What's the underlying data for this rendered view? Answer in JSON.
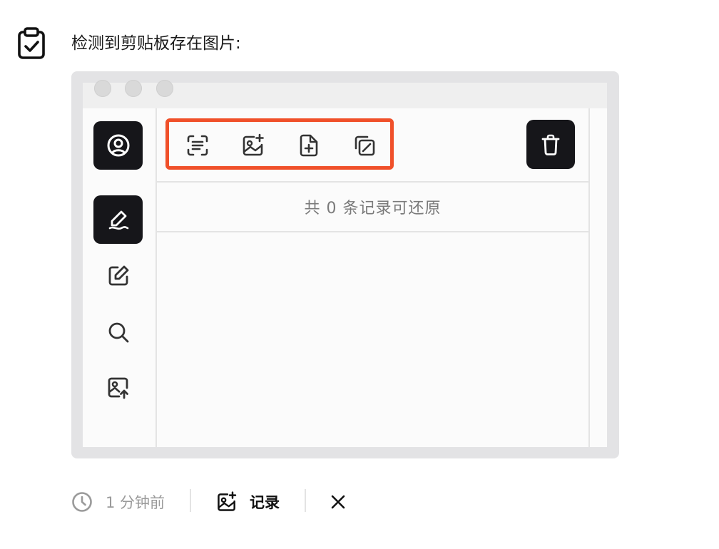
{
  "header": {
    "message": "检测到剪贴板存在图片:",
    "icon": "clipboard-check-icon"
  },
  "preview": {
    "sidebar": {
      "items": [
        {
          "icon": "user-circle-icon",
          "active": true
        },
        {
          "icon": "signature-icon",
          "active": true
        },
        {
          "icon": "edit-icon",
          "active": false
        },
        {
          "icon": "search-icon",
          "active": false
        },
        {
          "icon": "image-upload-icon",
          "active": false
        }
      ]
    },
    "toolbar": {
      "tools": [
        {
          "icon": "text-scan-icon"
        },
        {
          "icon": "image-add-icon"
        },
        {
          "icon": "file-add-icon"
        },
        {
          "icon": "copy-edit-icon"
        }
      ],
      "trash_icon": "trash-icon",
      "highlight_color": "#f0502a"
    },
    "records_text": "共 0 条记录可还原"
  },
  "footer": {
    "time_icon": "clock-icon",
    "time": "1 分钟前",
    "record_icon": "image-add-icon",
    "record_label": "记录",
    "close_icon": "close-icon"
  }
}
